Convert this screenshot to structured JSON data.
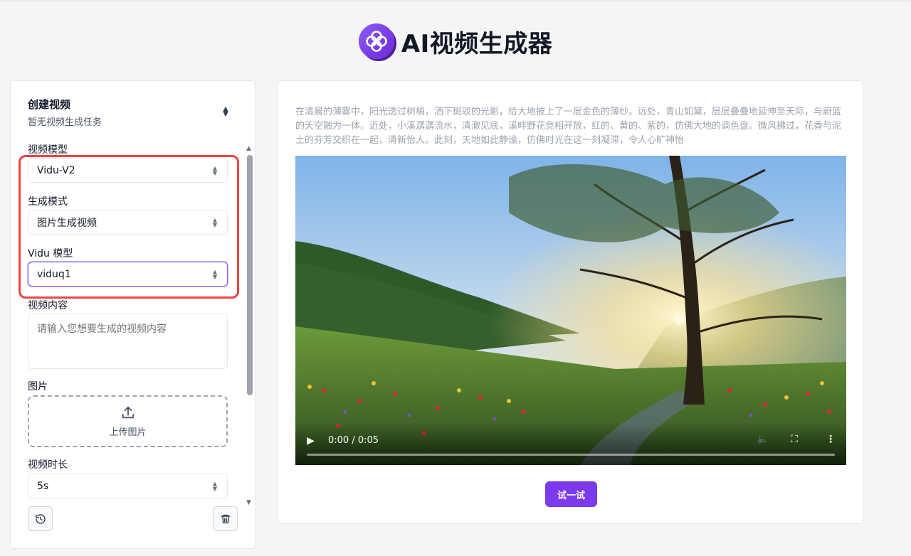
{
  "app": {
    "title": "AI视频生成器",
    "logo_icon": "flower-logo-icon",
    "accent": "#7c3aed"
  },
  "sidebar": {
    "title": "创建视频",
    "subtitle": "暂无视频生成任务",
    "expand_icon": "chevron-updown-icon",
    "fields": {
      "video_model": {
        "label": "视频模型",
        "value": "Vidu-V2"
      },
      "gen_mode": {
        "label": "生成模式",
        "value": "图片生成视频"
      },
      "vidu_model": {
        "label": "Vidu 模型",
        "value": "viduq1"
      },
      "content": {
        "label": "视频内容",
        "placeholder": "请输入您想要生成的视频内容"
      },
      "image": {
        "label": "图片",
        "upload_label": "上传图片",
        "icon": "upload-icon"
      },
      "duration": {
        "label": "视频时长",
        "value": "5s"
      }
    },
    "history_icon": "history-icon",
    "delete_icon": "trash-icon"
  },
  "main": {
    "description": "在清晨的薄雾中，阳光透过树梢，洒下斑驳的光影，给大地披上了一层金色的薄纱。远处，青山如黛，层层叠叠地延伸至天际，与蔚蓝的天空融为一体。近处，小溪潺潺流水，清澈见底，溪畔野花竞相开放，红的、黄的、紫的，仿佛大地的调色盘。微风拂过，花香与泥土的芬芳交织在一起，清新怡人。此刻，天地如此静谧，仿佛时光在这一刻凝滞，令人心旷神怡",
    "video": {
      "time": "0:00 / 0:05",
      "progress": 0
    },
    "try_button": "试一试"
  }
}
